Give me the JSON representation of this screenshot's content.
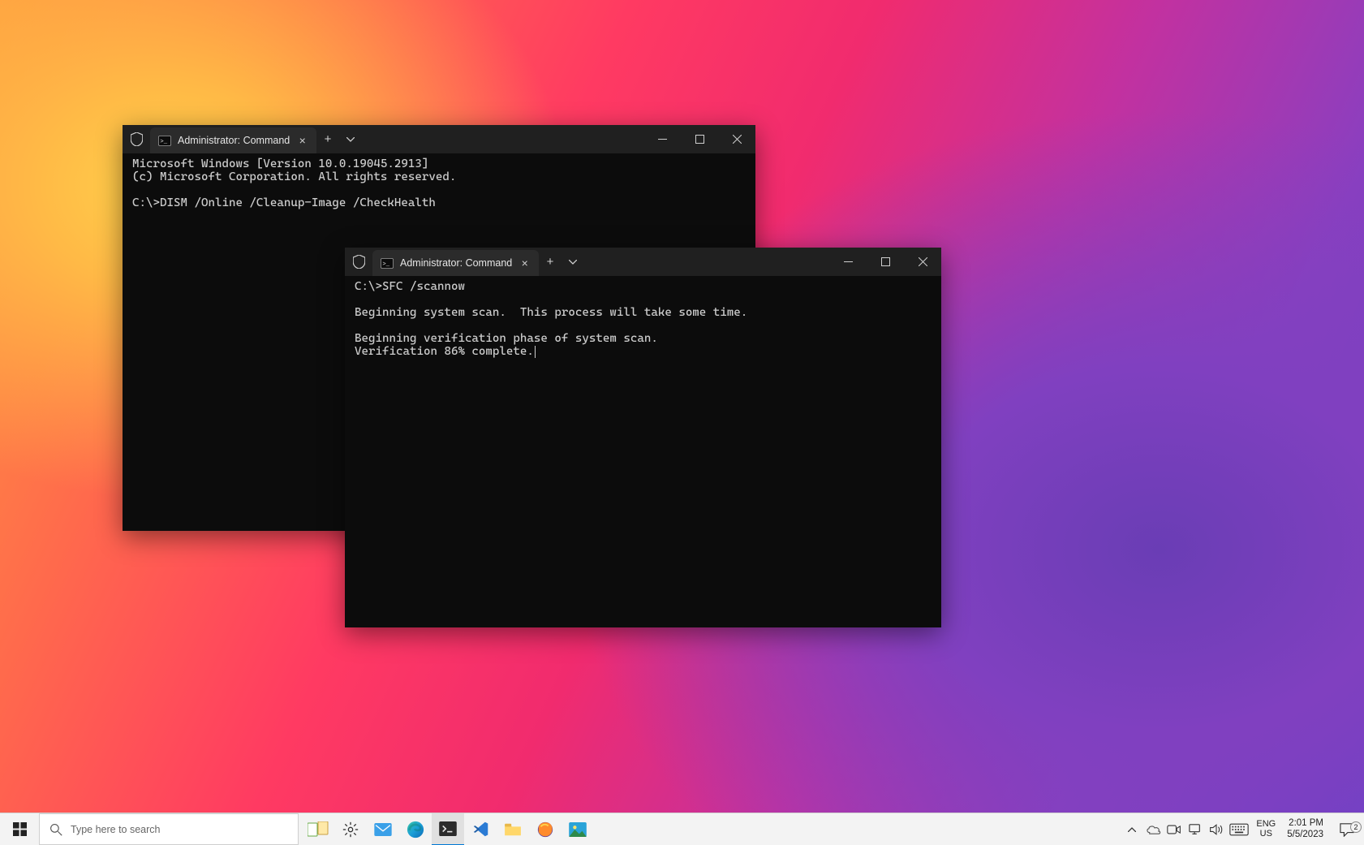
{
  "windows": {
    "back": {
      "tab_title": "Administrator: Command Prom",
      "lines": {
        "l0": "Microsoft Windows [Version 10.0.19045.2913]",
        "l1": "(c) Microsoft Corporation. All rights reserved.",
        "l2": "",
        "l3": "C:\\>DISM /Online /Cleanup-Image /CheckHealth"
      }
    },
    "front": {
      "tab_title": "Administrator: Command Prom",
      "lines": {
        "l0": "C:\\>SFC /scannow",
        "l1": "",
        "l2": "Beginning system scan.  This process will take some time.",
        "l3": "",
        "l4": "Beginning verification phase of system scan.",
        "l5": "Verification 86% complete."
      }
    }
  },
  "taskbar": {
    "search_placeholder": "Type here to search",
    "lang_top": "ENG",
    "lang_bottom": "US",
    "time": "2:01 PM",
    "date": "5/5/2023",
    "notif_count": "2"
  }
}
